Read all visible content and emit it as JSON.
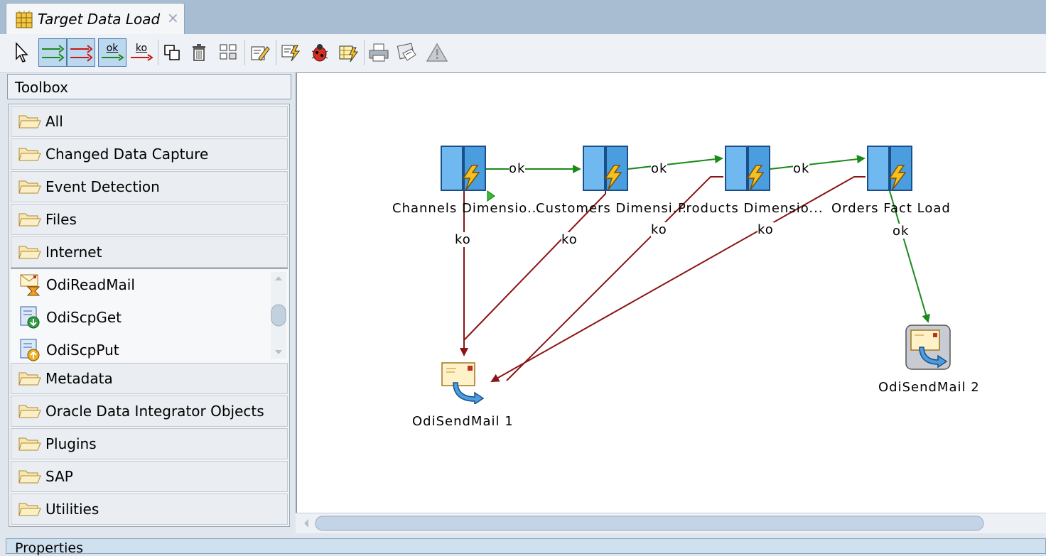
{
  "window": {
    "tab_title": "Target Data Load",
    "close_glyph": "×"
  },
  "toolbar": {
    "items": [
      "select-pointer",
      "ok-ko-link",
      "ko-link",
      "ok-link",
      "ko-link-single",
      "duplicate",
      "delete",
      "arrange",
      "edit-step",
      "execute",
      "debug",
      "generate",
      "print",
      "page-setup",
      "warning"
    ],
    "ok_label": "ok",
    "ko_label": "ko"
  },
  "toolbox": {
    "title": "Toolbox",
    "categories_top": [
      "All",
      "Changed Data Capture",
      "Event Detection",
      "Files",
      "Internet"
    ],
    "internet_items": [
      "OdiReadMail",
      "OdiScpGet",
      "OdiScpPut"
    ],
    "categories_bottom": [
      "Metadata",
      "Oracle Data Integrator Objects",
      "Plugins",
      "SAP",
      "Utilities"
    ]
  },
  "diagram": {
    "steps": [
      {
        "label": "Channels Dimensio...",
        "icon": "interface-step-icon"
      },
      {
        "label": "Customers Dimensi...",
        "icon": "interface-step-icon"
      },
      {
        "label": "Products Dimensio...",
        "icon": "interface-step-icon"
      },
      {
        "label": "Orders Fact Load",
        "icon": "interface-step-icon"
      },
      {
        "label": "OdiSendMail 1",
        "icon": "send-mail-icon"
      },
      {
        "label": "OdiSendMail 2",
        "icon": "send-mail-icon"
      }
    ],
    "link_labels": {
      "ok": "ok",
      "ko": "ko"
    },
    "colors": {
      "ok": "#1a8a1a",
      "ko": "#8b1414"
    }
  },
  "properties": {
    "title": "Properties"
  }
}
